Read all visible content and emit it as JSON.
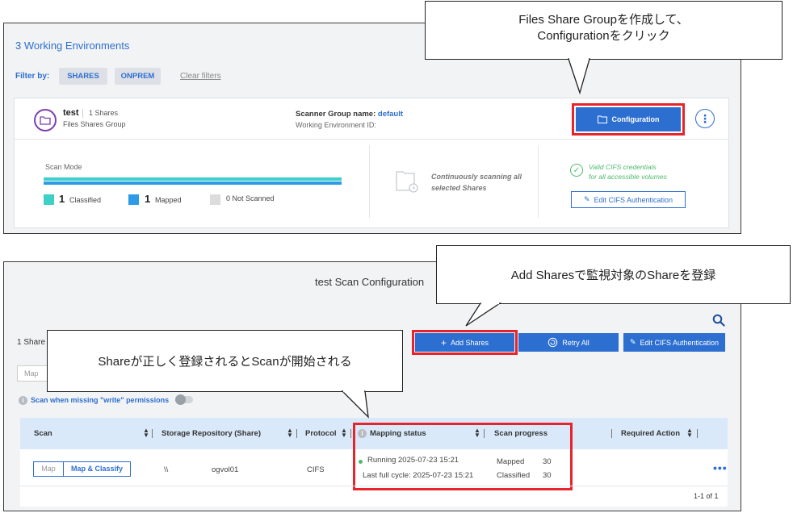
{
  "top": {
    "title": "3 Working Environments",
    "filter_label": "Filter by:",
    "filters": [
      "SHARES",
      "ONPREM"
    ],
    "clear_filters": "Clear filters",
    "card": {
      "name": "test",
      "shares_count": "1 Shares",
      "group_type": "Files Shares Group",
      "scanner_group_label": "Scanner Group name:",
      "scanner_group_value": "default",
      "working_env_id": "Working Environment ID:",
      "configuration_label": "Configuration",
      "scan_mode_label": "Scan Mode",
      "classified_count": "1",
      "classified_label": "Classified",
      "mapped_count": "1",
      "mapped_label": "Mapped",
      "not_scanned_label": "0 Not Scanned",
      "continuous_line1": "Continuously scanning all",
      "continuous_line2": "selected Shares",
      "valid_line1": "Valid CIFS credentials",
      "valid_line2": "for all accessible volumes",
      "edit_cifs_label": "Edit CIFS Authentication"
    }
  },
  "callouts": {
    "c1_line1": "Files Share Groupを作成して、",
    "c1_line2": "Configurationをクリック",
    "c2": "Add Sharesで監視対象のShareを登録",
    "c3": "Shareが正しく登録されるとScanが開始される"
  },
  "bottom": {
    "title": "test Scan Configuration",
    "shares_label": "1 Share",
    "add_shares": "Add Shares",
    "retry_all": "Retry All",
    "edit_cifs": "Edit CIFS Authentication",
    "map_filter": "Map",
    "missing_write": "Scan when missing \"write\" permissions",
    "columns": {
      "scan": "Scan",
      "repo": "Storage Repository (Share)",
      "protocol": "Protocol",
      "mapping": "Mapping status",
      "progress": "Scan progress",
      "required": "Required Action"
    },
    "row": {
      "seg_map": "Map",
      "seg_map_classify": "Map & Classify",
      "backslash": "\\\\",
      "share": "ogvol01",
      "protocol": "CIFS",
      "running": "Running 2025-07-23 15:21",
      "last_cycle": "Last full cycle: 2025-07-23 15:21",
      "mapped_label": "Mapped",
      "mapped_value": "30",
      "classified_label": "Classified",
      "classified_value": "30"
    },
    "pager": "1-1 of 1"
  }
}
